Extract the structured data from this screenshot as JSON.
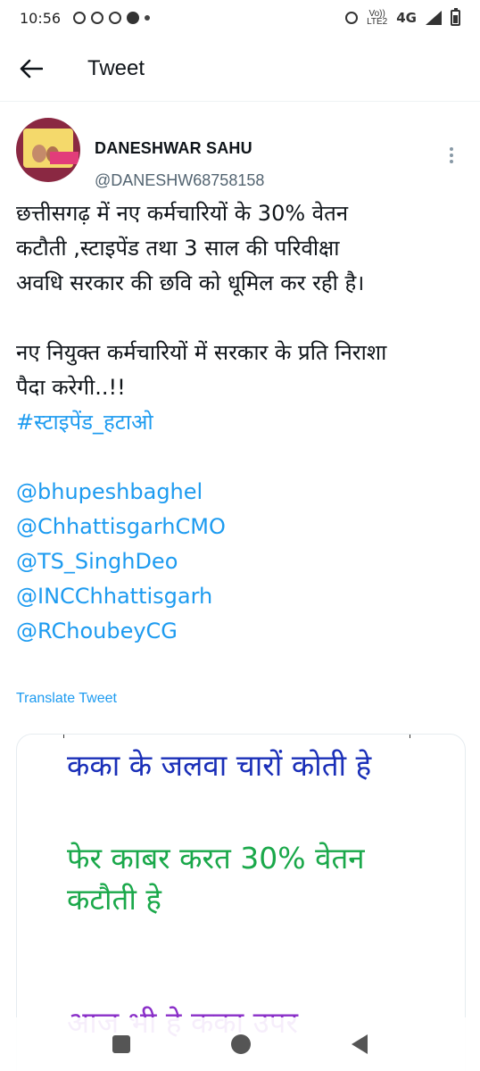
{
  "status_bar": {
    "time": "10:56",
    "network_label_top": "Vo))",
    "network_label_bottom": "LTE2",
    "signal_label": "4G"
  },
  "header": {
    "title": "Tweet",
    "back_icon": "arrow-left-icon"
  },
  "tweet": {
    "author_name": "DANESHWAR SAHU",
    "author_handle": "@DANESHW68758158",
    "body_lines": [
      "छत्तीसगढ़ में नए कर्मचारियों के 30% वेतन",
      "कटौती ,स्टाइपेंड तथा 3 साल की परिवीक्षा",
      "अवधि सरकार की छवि को धूमिल कर रही है।",
      "नए नियुक्त कर्मचारियों में सरकार के प्रति निराशा",
      "पैदा करेगी..!!"
    ],
    "hashtag": "#स्टाइपेंड_हटाओ",
    "mentions": [
      "@bhupeshbaghel",
      "@ChhattisgarhCMO",
      "@TS_SinghDeo",
      "@INCChhattisgarh",
      "@RChoubeyCG"
    ],
    "translate_label": "Translate Tweet",
    "media": {
      "line1": "कका के जलवा चारों कोती हे",
      "line2": "फेर काबर करत  30% वेतन कटौती हे",
      "line3": "आज भी हे कका उपर"
    }
  },
  "colors": {
    "link": "#1d9bf0",
    "text": "#0f1419",
    "secondary": "#536471",
    "media_blue": "#1a2fb8",
    "media_green": "#1aa84a",
    "media_purple": "#8a2fc8"
  }
}
